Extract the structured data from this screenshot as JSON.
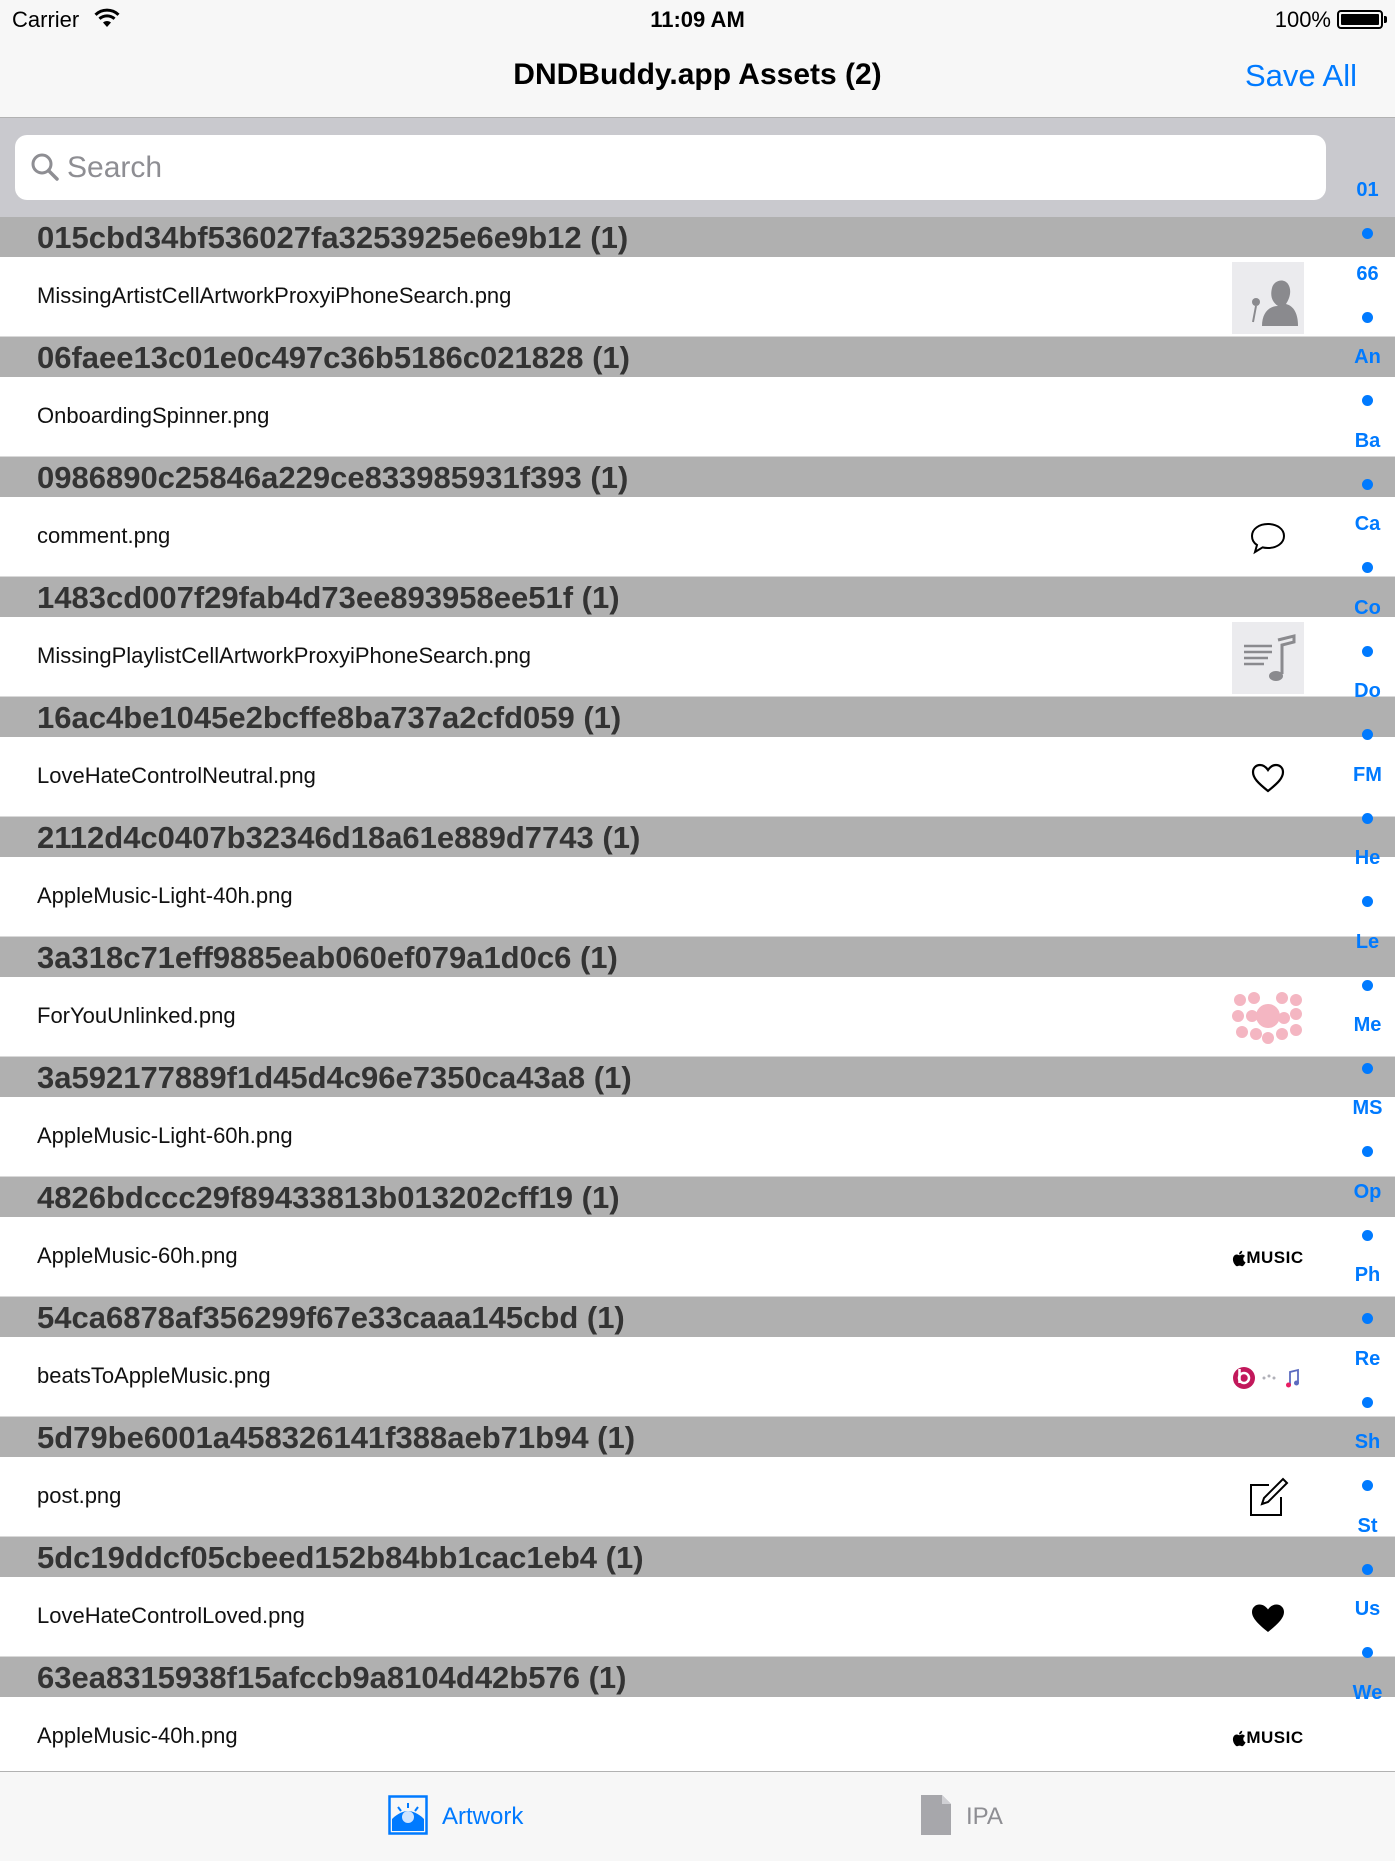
{
  "status_bar": {
    "carrier": "Carrier",
    "time": "11:09 AM",
    "battery": "100%"
  },
  "nav": {
    "title": "DNDBuddy.app Assets (2)",
    "save_all": "Save All"
  },
  "search": {
    "placeholder": "Search",
    "value": ""
  },
  "sections": [
    {
      "header": "015cbd34bf536027fa3253925e6e9b12 (1)",
      "file": "MissingArtistCellArtworkProxyiPhoneSearch.png",
      "thumb": "artist-placeholder-icon"
    },
    {
      "header": "06faee13c01e0c497c36b5186c021828 (1)",
      "file": "OnboardingSpinner.png",
      "thumb": ""
    },
    {
      "header": "0986890c25846a229ce833985931f393 (1)",
      "file": "comment.png",
      "thumb": "comment-icon"
    },
    {
      "header": "1483cd007f29fab4d73ee893958ee51f (1)",
      "file": "MissingPlaylistCellArtworkProxyiPhoneSearch.png",
      "thumb": "playlist-placeholder-icon"
    },
    {
      "header": "16ac4be1045e2bcffe8ba737a2cfd059 (1)",
      "file": "LoveHateControlNeutral.png",
      "thumb": "heart-outline-icon"
    },
    {
      "header": "2112d4c0407b32346d18a61e889d7743 (1)",
      "file": "AppleMusic-Light-40h.png",
      "thumb": ""
    },
    {
      "header": "3a318c71eff9885eab060ef079a1d0c6 (1)",
      "file": "ForYouUnlinked.png",
      "thumb": "for-you-bubbles-icon"
    },
    {
      "header": "3a592177889f1d45d4c96e7350ca43a8 (1)",
      "file": "AppleMusic-Light-60h.png",
      "thumb": ""
    },
    {
      "header": "4826bdccc29f89433813b013202cff19 (1)",
      "file": "AppleMusic-60h.png",
      "thumb": "apple-music-logo-icon"
    },
    {
      "header": "54ca6878af356299f67e33caaa145cbd (1)",
      "file": "beatsToAppleMusic.png",
      "thumb": "beats-to-music-icon"
    },
    {
      "header": "5d79be6001a458326141f388aeb71b94 (1)",
      "file": "post.png",
      "thumb": "compose-icon"
    },
    {
      "header": "5dc19ddcf05cbeed152b84bb1cac1eb4 (1)",
      "file": "LoveHateControlLoved.png",
      "thumb": "heart-filled-icon"
    },
    {
      "header": "63ea8315938f15afccb9a8104d42b576 (1)",
      "file": "AppleMusic-40h.png",
      "thumb": "apple-music-logo-icon"
    }
  ],
  "logo_text": {
    "music": "MUSIC"
  },
  "index": [
    "01",
    "66",
    "An",
    "Ba",
    "Ca",
    "Co",
    "Do",
    "FM",
    "He",
    "Le",
    "Me",
    "MS",
    "Op",
    "Ph",
    "Re",
    "Sh",
    "St",
    "Us",
    "We"
  ],
  "tabs": [
    {
      "label": "Artwork",
      "icon": "artwork-icon",
      "selected": true
    },
    {
      "label": "IPA",
      "icon": "document-icon",
      "selected": false
    }
  ],
  "colors": {
    "accent": "#007aff",
    "section_header_bg": "#b0b0b0",
    "search_bar_bg": "#c9c9ce",
    "bar_bg": "#f7f7f7"
  }
}
